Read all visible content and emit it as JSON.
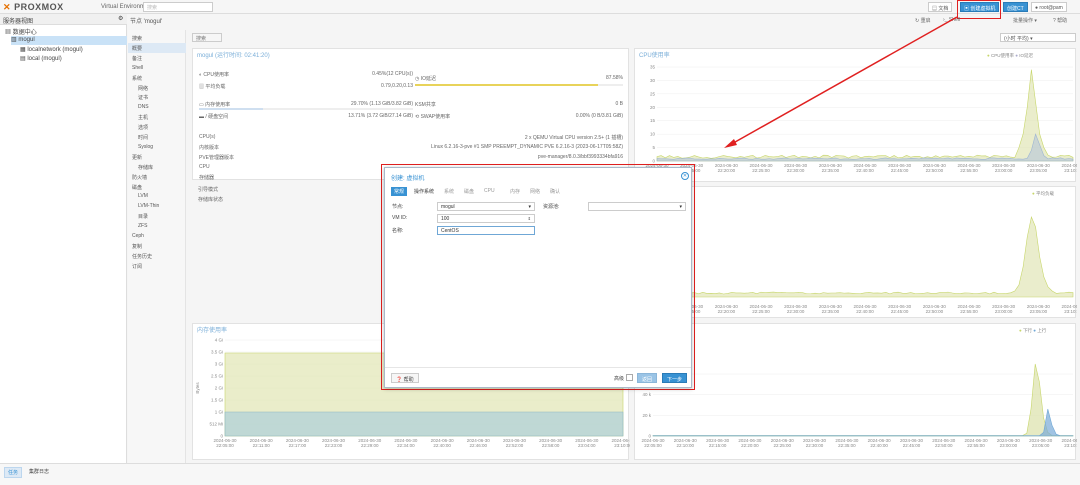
{
  "topbar": {
    "logo": "PROXMOX",
    "version": "Virtual Environment 8.0.3",
    "search_placeholder": "搜索",
    "doc_btn": "文档",
    "create_vm_btn": "创建虚拟机",
    "create_ct_btn": "创建CT",
    "user_btn": "root@pam"
  },
  "tree": {
    "view": "服务器视图",
    "datacenter": "数据中心",
    "node": "mogul",
    "storages": [
      "localnetwork (mogul)",
      "local (mogul)"
    ]
  },
  "breadcrumb": "节点 'mogul'",
  "actions": {
    "reboot": "重启",
    "shell": "Shell",
    "bulk": "批量操作",
    "help": "帮助"
  },
  "search_btn": "搜索",
  "nav": [
    {
      "label": "搜索",
      "sub": false
    },
    {
      "label": "概要",
      "sub": false,
      "sel": true
    },
    {
      "label": "备注",
      "sub": false
    },
    {
      "label": "Shell",
      "sub": false
    },
    {
      "label": "系统",
      "sub": false
    },
    {
      "label": "网络",
      "sub": true
    },
    {
      "label": "证书",
      "sub": true
    },
    {
      "label": "DNS",
      "sub": true
    },
    {
      "label": "主机",
      "sub": true
    },
    {
      "label": "选项",
      "sub": true
    },
    {
      "label": "时间",
      "sub": true
    },
    {
      "label": "Syslog",
      "sub": true
    },
    {
      "label": "更新",
      "sub": false
    },
    {
      "label": "存储库",
      "sub": true
    },
    {
      "label": "防火墙",
      "sub": false
    },
    {
      "label": "磁盘",
      "sub": false
    },
    {
      "label": "LVM",
      "sub": true
    },
    {
      "label": "LVM-Thin",
      "sub": true
    },
    {
      "label": "目录",
      "sub": true
    },
    {
      "label": "ZFS",
      "sub": true
    },
    {
      "label": "Ceph",
      "sub": false
    },
    {
      "label": "复制",
      "sub": false
    },
    {
      "label": "任务历史",
      "sub": false
    },
    {
      "label": "订阅",
      "sub": false
    }
  ],
  "timeframe": "(小时 平均)",
  "summary": {
    "title": "mogul (运行时间: 02:41:20)",
    "cpu_label": "CPU使用率",
    "cpu_value": "0.45%(12 CPU(s))",
    "io_label": "IO延迟",
    "io_value": "87.58%",
    "io_fraction": 0.88,
    "load_label": "平均负载",
    "load_value": "0.79,0.20,0.13",
    "mem_label": "内存使用率",
    "mem_value": "29.70% (1.13 GiB/3.82 GiB)",
    "ksm_label": "KSM共享",
    "ksm_value": "0 B",
    "disk_label": "/ 硬盘空间",
    "disk_value": "13.71% (3.72 GiB/27.14 GiB)",
    "swap_label": "SWAP使用率",
    "swap_value": "0.00% (0 B/3.81 GiB)",
    "cpus_label": "CPU(s)",
    "cpus_value": "2 x QEMU Virtual CPU version 2.5+ (1 插槽)",
    "kernel_label": "内核版本",
    "kernel_value": "Linux 6.2.16-3-pve #1 SMP PREEMPT_DYNAMIC PVE 6.2.16-3 (2023-06-17T05:58Z)",
    "pve_label": "PVE管理器版本",
    "pve_value": "pve-manager/8.0.3/bbf3993334bfa916",
    "extra_labels": [
      "CPU",
      "存储器",
      "引导模式",
      "存储库状态"
    ]
  },
  "cpu_chart": {
    "title": "CPU使用率",
    "legend": [
      "CPU使用率",
      "IO延迟"
    ],
    "yticks": [
      "35",
      "30",
      "25",
      "20",
      "15",
      "10",
      "5",
      "0"
    ],
    "xticks": [
      "2024-06-30 22:10:00",
      "2024-06-30 22:15:00",
      "2024-06-30 22:20:00",
      "2024-06-30 22:25:00",
      "2024-06-30 22:30:00",
      "2024-06-30 22:35:00",
      "2024-06-30 22:40:00",
      "2024-06-30 22:45:00",
      "2024-06-30 22:50:00",
      "2024-06-30 22:55:00",
      "2024-06-30 23:00:00",
      "2024-06-30 23:05:00",
      "2024-06-30 23:10:00"
    ]
  },
  "load_chart": {
    "legend": [
      "平均负载"
    ]
  },
  "mem_chart": {
    "title": "内存使用率",
    "yticks": [
      "4 Gi",
      "3.5 Gi",
      "3 Gi",
      "2.5 Gi",
      "2 Gi",
      "1.5 Gi",
      "1 Gi",
      "512 Mi",
      "0"
    ],
    "ylabel": "Bytes",
    "xticks": [
      "2024-06-30 22:05:00",
      "2024-06-30 22:11:00",
      "2024-06-30 22:17:00",
      "2024-06-30 22:23:00",
      "2024-06-30 22:29:00",
      "2024-06-30 22:34:00",
      "2024-06-30 22:40:00",
      "2024-06-30 22:46:00",
      "2024-06-30 22:52:00",
      "2024-06-30 22:58:00",
      "2024-06-30 23:04:00",
      "2024-06-30 23:10:00"
    ]
  },
  "net_chart": {
    "legend": [
      "下行",
      "上行"
    ],
    "yticks": [
      "60 k",
      "40 k",
      "20 k",
      "0"
    ],
    "xticks": [
      "2024-06-30 22:05:00",
      "2024-06-30 22:10:00",
      "2024-06-30 22:15:00",
      "2024-06-30 22:20:00",
      "2024-06-30 22:25:00",
      "2024-06-30 22:30:00",
      "2024-06-30 22:35:00",
      "2024-06-30 22:40:00",
      "2024-06-30 22:45:00",
      "2024-06-30 22:50:00",
      "2024-06-30 22:55:00",
      "2024-06-30 23:00:00",
      "2024-06-30 23:05:00",
      "2024-06-30 23:10:00"
    ]
  },
  "statusbar": {
    "tab1": "任务",
    "tab2": "集群日志"
  },
  "dialog": {
    "title": "创建: 虚拟机",
    "tabs": [
      "常规",
      "操作系统",
      "系统",
      "磁盘",
      "CPU",
      "内存",
      "网络",
      "确认"
    ],
    "node_label": "节点:",
    "node_value": "mogul",
    "vmid_label": "VM ID:",
    "vmid_value": "100",
    "name_label": "名称:",
    "name_value": "CentOS",
    "pool_label": "资源池:",
    "help_btn": "帮助",
    "advanced_label": "高级",
    "back_btn": "返回",
    "next_btn": "下一步"
  }
}
